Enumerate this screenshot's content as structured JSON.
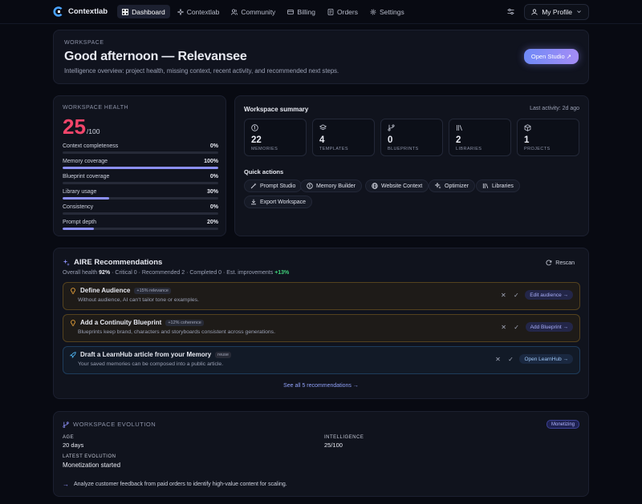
{
  "nav": {
    "brand": "Contextlab",
    "items": [
      {
        "label": "Dashboard",
        "icon": "dashboard-icon"
      },
      {
        "label": "Contextlab",
        "icon": "sparkle-icon"
      },
      {
        "label": "Community",
        "icon": "users-icon"
      },
      {
        "label": "Billing",
        "icon": "card-icon"
      },
      {
        "label": "Orders",
        "icon": "list-icon"
      },
      {
        "label": "Settings",
        "icon": "gear-icon"
      }
    ],
    "profile_label": "My Profile"
  },
  "hero": {
    "eyebrow": "WORKSPACE",
    "title": "Good afternoon — Relevansee",
    "subtitle": "Intelligence overview: project health, missing context, recent activity, and recommended next steps.",
    "cta": "Open Studio ↗"
  },
  "health": {
    "eyebrow": "WORKSPACE HEALTH",
    "score": "25",
    "score_max": "/100",
    "metrics": [
      {
        "label": "Context completeness",
        "value": "0%",
        "pct": 0
      },
      {
        "label": "Memory coverage",
        "value": "100%",
        "pct": 100
      },
      {
        "label": "Blueprint coverage",
        "value": "0%",
        "pct": 0
      },
      {
        "label": "Library usage",
        "value": "30%",
        "pct": 30
      },
      {
        "label": "Consistency",
        "value": "0%",
        "pct": 0
      },
      {
        "label": "Prompt depth",
        "value": "20%",
        "pct": 20
      }
    ]
  },
  "summary": {
    "title": "Workspace summary",
    "last_activity": "Last activity: 2d ago",
    "stats": [
      {
        "num": "22",
        "label": "MEMORIES",
        "icon": "memory-icon"
      },
      {
        "num": "4",
        "label": "TEMPLATES",
        "icon": "layers-icon"
      },
      {
        "num": "0",
        "label": "BLUEPRINTS",
        "icon": "branch-icon"
      },
      {
        "num": "2",
        "label": "LIBRARIES",
        "icon": "library-icon"
      },
      {
        "num": "1",
        "label": "PROJECTS",
        "icon": "box-icon"
      }
    ],
    "quick_actions_title": "Quick actions",
    "quick_actions": [
      "Prompt Studio",
      "Memory Builder",
      "Website Context",
      "Optimizer",
      "Libraries",
      "Export Workspace"
    ]
  },
  "aire": {
    "title": "AIRE Recommendations",
    "overall_label": "Overall health",
    "overall_value": "92%",
    "stats_text": " · Critical 0 · Recommended 2 · Completed 0 · Est. improvements ",
    "improvement": "+13%",
    "rescan": "Rescan",
    "recs": [
      {
        "title": "Define Audience",
        "tag": "+15% relevance",
        "desc": "Without audience, AI can't tailor tone or examples.",
        "action": "Edit audience →"
      },
      {
        "title": "Add a Continuity Blueprint",
        "tag": "+12% coherence",
        "desc": "Blueprints keep brand, characters and storyboards consistent across generations.",
        "action": "Add Blueprint →"
      },
      {
        "title": "Draft a LearnHub article from your Memory",
        "tag": "reuse",
        "desc": "Your saved memories can be composed into a public article.",
        "action": "Open LearnHub →"
      }
    ],
    "see_all": "See all 5 recommendations →"
  },
  "evolution": {
    "eyebrow": "WORKSPACE EVOLUTION",
    "badge": "Monetizing",
    "age_label": "AGE",
    "age_value": "20 days",
    "intel_label": "INTELLIGENCE",
    "intel_value": "25/100",
    "latest_label": "LATEST EVOLUTION",
    "latest_value": "Monetization started",
    "next_step": "Analyze customer feedback from paid orders to identify high-value content for scaling."
  },
  "colors": {
    "accent": "#8b8ff5",
    "score": "#f2456a",
    "positive": "#3fd07a",
    "amber": "#e8a23a"
  }
}
